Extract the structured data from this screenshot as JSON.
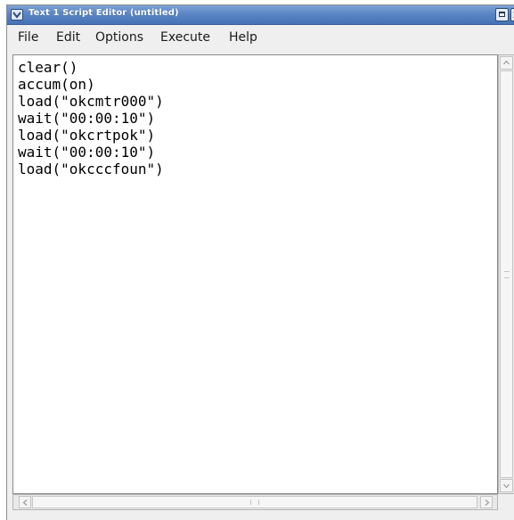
{
  "window": {
    "title": "Text 1 Script Editor (untitled)"
  },
  "icons": {
    "window_menu": "chevron-down-icon",
    "maximize": "maximize-icon",
    "close": "close-icon"
  },
  "menu": {
    "file": "File",
    "edit": "Edit",
    "options": "Options",
    "execute": "Execute",
    "help": "Help"
  },
  "editor": {
    "lines": [
      "clear()",
      "accum(on)",
      "load(\"okcmtr000\")",
      "wait(\"00:00:10\")",
      "load(\"okcrtpok\")",
      "wait(\"00:00:10\")",
      "load(\"okcccfoun\")"
    ]
  },
  "colors": {
    "titlebar": "#5b86c4",
    "window_bg": "#efefef",
    "editor_bg": "#ffffff",
    "text": "#000000"
  }
}
